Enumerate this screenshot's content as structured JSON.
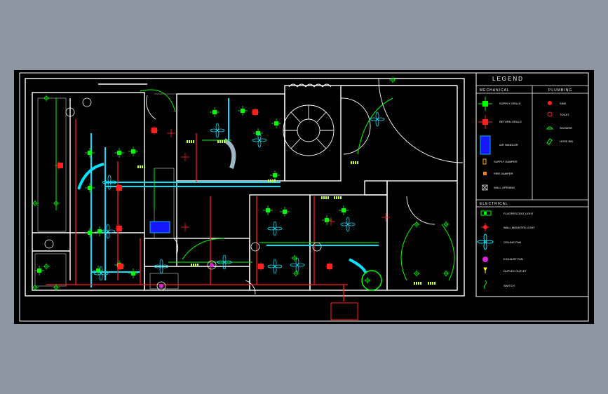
{
  "legend": {
    "title": "LEGEND",
    "mechanical_header": "MECHANICAL",
    "plumbing_header": "PLUMBING",
    "electrical_header": "ELECTRICAL",
    "mechanical_items": [
      "SUPPLY GRILLE",
      "RETURN GRILLE",
      "AIR HANDLER",
      "SUPPLY DAMPER",
      "FIRE DAMPER",
      "WALL OPENING"
    ],
    "plumbing_items": [
      "SINK",
      "TOILET",
      "SHOWER",
      "HOSE BIB"
    ],
    "electrical_items": [
      "FLUORESCENT LIGHT",
      "WALL MOUNTED LIGHT",
      "CEILING FAN",
      "EXHAUST FAN",
      "DUPLEX OUTLET",
      "SWITCH"
    ]
  },
  "colors": {
    "background": "#8e96a1",
    "panel": "#000000",
    "walls": "#ffffff",
    "circuit": "#ff2020",
    "conduit": "#00ff00",
    "duct": "#00e5ff",
    "fixture": "#ffffff"
  }
}
